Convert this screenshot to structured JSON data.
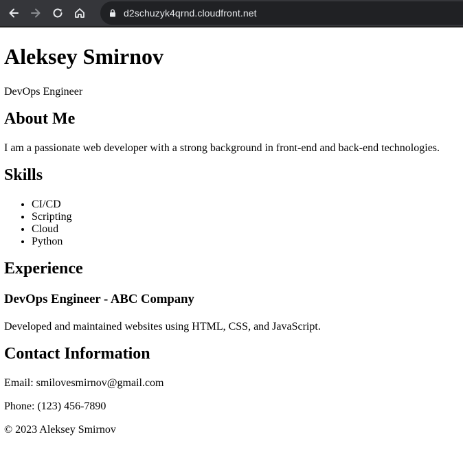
{
  "browser": {
    "url": "d2schuzyk4qrnd.cloudfront.net"
  },
  "page": {
    "name": "Aleksey Smirnov",
    "title": "DevOps Engineer",
    "about": {
      "heading": "About Me",
      "text": "I am a passionate web developer with a strong background in front-end and back-end technologies."
    },
    "skills": {
      "heading": "Skills",
      "items": [
        "CI/CD",
        "Scripting",
        "Cloud",
        "Python"
      ]
    },
    "experience": {
      "heading": "Experience",
      "job_title": "DevOps Engineer - ABC Company",
      "job_description": "Developed and maintained websites using HTML, CSS, and JavaScript."
    },
    "contact": {
      "heading": "Contact Information",
      "email": "Email: smilovesmirnov@gmail.com",
      "phone": "Phone: (123) 456-7890"
    },
    "footer": "© 2023 Aleksey Smirnov"
  }
}
